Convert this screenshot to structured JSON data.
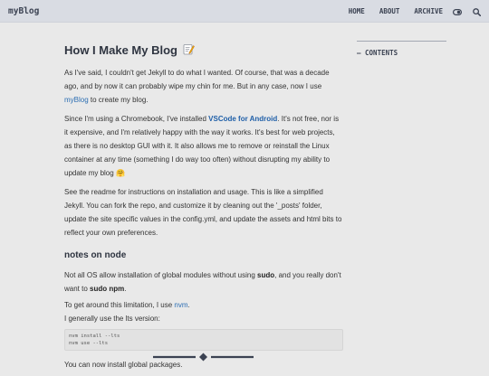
{
  "header": {
    "logo": "myBlog",
    "nav": [
      "HOME",
      "ABOUT",
      "ARCHIVE"
    ]
  },
  "article": {
    "title": "How I Make My Blog",
    "p1": {
      "a": "As I've said, I couldn't get Jekyll to do what I wanted. Of course, that was a decade ago, and by now it can probably wipe my chin for me. But in any case, now I use ",
      "link": "myBlog",
      "b": " to create my blog."
    },
    "p2": {
      "a": "Since I'm using a Chromebook, I've installed ",
      "link": "VSCode for Android",
      "b": ". It's not free, nor is it expensive, and I'm relatively happy with the way it works. It's best for web projects, as there is no desktop GUI with it. It also allows me to remove or reinstall the Linux container at any time (something I do way too often) without disrupting my ability to update my blog ",
      "emoji": "🤗"
    },
    "p3": "See the readme for instructions on installation and usage. This is like a simplified Jekyll. You can fork the repo, and customize it by cleaning out the '_posts' folder, update the site specific values in the config.yml, and update the assets and html bits to reflect your own preferences.",
    "h2": "notes on node",
    "p4": {
      "a": "Not all OS allow installation of global modules without using ",
      "sudo": "sudo",
      "b": ", and you really don't want to ",
      "sudo_npm": "sudo npm",
      "c": "."
    },
    "p5": {
      "a": "To get around this limitation, I use ",
      "link": "nvm",
      "b": "."
    },
    "p6": "I generally use the lts version:",
    "code": [
      "nvm install --lts",
      "nvm use --lts"
    ],
    "p7": "You can now install global packages."
  },
  "toc": {
    "label": "— CONTENTS"
  },
  "colors": {
    "header_bg": "#d9dce3",
    "page_bg": "#e9e9e9",
    "link": "#2d6fb3",
    "accent": "#3b4252"
  },
  "icons": [
    "theme-toggle-icon",
    "search-icon",
    "memo-icon",
    "diamond-divider-icon"
  ]
}
